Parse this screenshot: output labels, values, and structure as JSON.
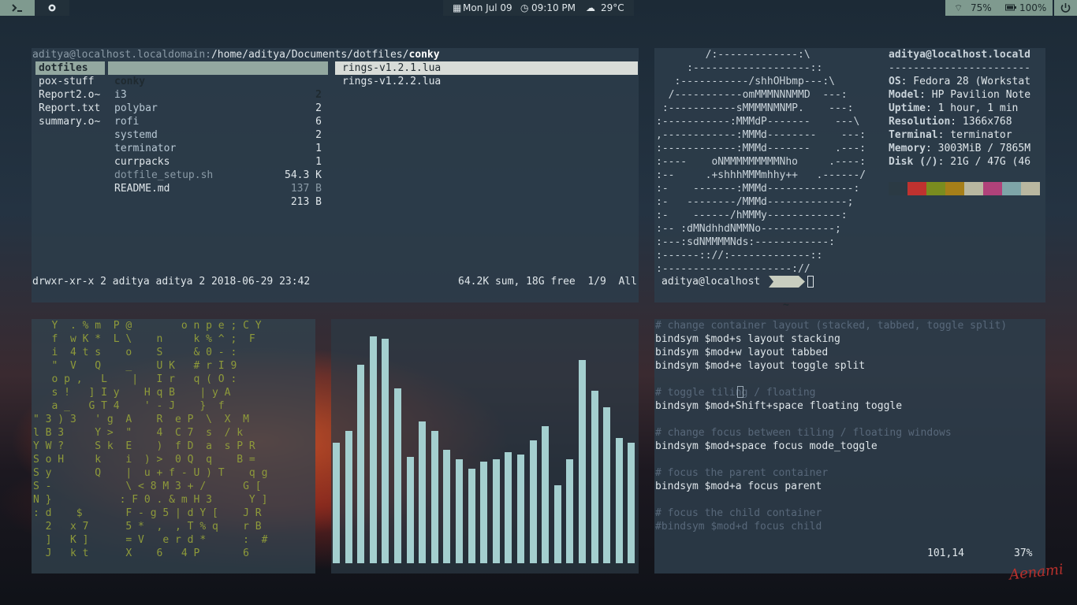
{
  "topbar": {
    "terminal_icon": "terminal-icon",
    "app_icon": "settings-icon",
    "date": "Mon Jul 09",
    "time": "09:10 PM",
    "weather": "29°C",
    "wifi": "75%",
    "battery": "100%"
  },
  "ranger": {
    "path_user": "aditya@localhost.localdomain:",
    "path_dir": "/home/aditya/Documents/dotfiles/",
    "path_current": "conky",
    "col1": [
      "dotfiles",
      "pox-stuff",
      "Report2.o~",
      "Report.txt",
      "summary.o~"
    ],
    "col2": [
      {
        "name": "conky",
        "size": "2"
      },
      {
        "name": "i3",
        "size": "2"
      },
      {
        "name": "polybar",
        "size": "6"
      },
      {
        "name": "rofi",
        "size": "2"
      },
      {
        "name": "systemd",
        "size": "1"
      },
      {
        "name": "terminator",
        "size": "1"
      },
      {
        "name": "currpacks",
        "size": "54.3 K"
      },
      {
        "name": "dotfile_setup.sh",
        "size": "137 B"
      },
      {
        "name": "README.md",
        "size": "213 B"
      }
    ],
    "col3": [
      "rings-v1.2.1.lua",
      "rings-v1.2.2.lua"
    ],
    "status_left": "drwxr-xr-x 2 aditya aditya 2 2018-06-29 23:42",
    "status_right": "64.2K sum, 18G free  1/9  All"
  },
  "neofetch": {
    "ascii": [
      "        /:-------------:\\",
      "     :-------------------::",
      "   :-----------/shhOHbmp---:\\",
      "  /-----------omMMMNNNMMD  ---:",
      " :-----------sMMMMNMNMP.    ---:",
      ":-----------:MMMdP-------    ---\\",
      ",------------:MMMd--------    ---:",
      ":------------:MMMd-------    .---:",
      ":----    oNMMMMMMMMMNho     .----:",
      ":--     .+shhhMMMmhhy++   .------/",
      ":-    -------:MMMd--------------:",
      ":-   --------/MMMd-------------;",
      ":-    ------/hMMMy------------:",
      ":-- :dMNdhhdNMMNo------------;",
      ":---:sdNMMMMNds:------------:",
      ":------:://:-------------::",
      ":---------------------://"
    ],
    "title": "aditya@localhost.locald",
    "separator": "-----------------------",
    "info": [
      {
        "key": "OS",
        "value": ": Fedora 28 (Workstat"
      },
      {
        "key": "Model",
        "value": ": HP Pavilion Note"
      },
      {
        "key": "Uptime",
        "value": ": 1 hour, 1 min"
      },
      {
        "key": "Resolution",
        "value": ": 1366x768"
      },
      {
        "key": "Terminal",
        "value": ": terminator"
      },
      {
        "key": "Memory",
        "value": ": 3003MiB / 7865M"
      },
      {
        "key": "Disk (/)",
        "value": ": 21G / 47G (46"
      }
    ],
    "palette": [
      "#2b3a44",
      "#c0322f",
      "#7a8c1f",
      "#a67f19",
      "#b8b7a0",
      "#b0427a",
      "#7ea5a8",
      "#b9b7a0"
    ],
    "prompt_user": "aditya@localhost",
    "prompt_dir": "~"
  },
  "matrix": {
    "lines": [
      "   Y  . % m  P @        o n p e ; C Y",
      "   f  w K *  L \\    n     k % ^ ;  F",
      "   i  4 t s    o    S     & 0 - :",
      "   \"  V   Q    _    U K   # r I 9",
      "   o p ,   L    |   I r   q ( O :",
      "   s !   ] I y    H q B    | y A",
      "   a _   G T 4    ' - J    }  f",
      "\" 3 ) 3   ' g  A    R  e P  \\  X  M",
      "l B 3     Y >  \"    4  C 7  s  / k",
      "Y W ?     S k  E    )  f D  a  s P R",
      "S o H     k    i  ) >  0 Q  q    B =",
      "S y       Q    |  u + f - U ) T    q g",
      "S -            \\ < 8 M 3 + /      G [",
      "N }           : F 0 . & m H 3      Y ]",
      ": d    $       F - g 5 | d Y [    J R",
      "  2   x 7      5 *  ,  , T % q    r B",
      "  ]   K ]      = V   e r d *      :  #",
      "  J   k t      X    6   4 P       6"
    ]
  },
  "visualizer": {
    "levels": [
      0.51,
      0.56,
      0.84,
      0.96,
      0.95,
      0.74,
      0.45,
      0.6,
      0.56,
      0.48,
      0.44,
      0.4,
      0.43,
      0.44,
      0.47,
      0.46,
      0.52,
      0.58,
      0.33,
      0.44,
      0.86,
      0.73,
      0.66,
      0.53,
      0.51
    ]
  },
  "editor": {
    "lines": [
      {
        "type": "comment",
        "text": "# change container layout (stacked, tabbed, toggle split)"
      },
      {
        "type": "code",
        "text": "bindsym $mod+s layout stacking"
      },
      {
        "type": "code",
        "text": "bindsym $mod+w layout tabbed"
      },
      {
        "type": "code",
        "text": "bindsym $mod+e layout toggle split"
      },
      {
        "type": "blank",
        "text": ""
      },
      {
        "type": "comment",
        "text": "# toggle tiling / floating"
      },
      {
        "type": "code",
        "text": "bindsym $mod+Shift+space floating toggle"
      },
      {
        "type": "blank",
        "text": ""
      },
      {
        "type": "comment",
        "text": "# change focus between tiling / floating windows"
      },
      {
        "type": "code",
        "text": "bindsym $mod+space focus mode_toggle"
      },
      {
        "type": "blank",
        "text": ""
      },
      {
        "type": "comment",
        "text": "# focus the parent container"
      },
      {
        "type": "code",
        "text": "bindsym $mod+a focus parent"
      },
      {
        "type": "blank",
        "text": ""
      },
      {
        "type": "comment",
        "text": "# focus the child container"
      },
      {
        "type": "comment",
        "text": "#bindsym $mod+d focus child"
      }
    ],
    "position": "101,14",
    "percent": "37%"
  },
  "watermark": "Aenami"
}
